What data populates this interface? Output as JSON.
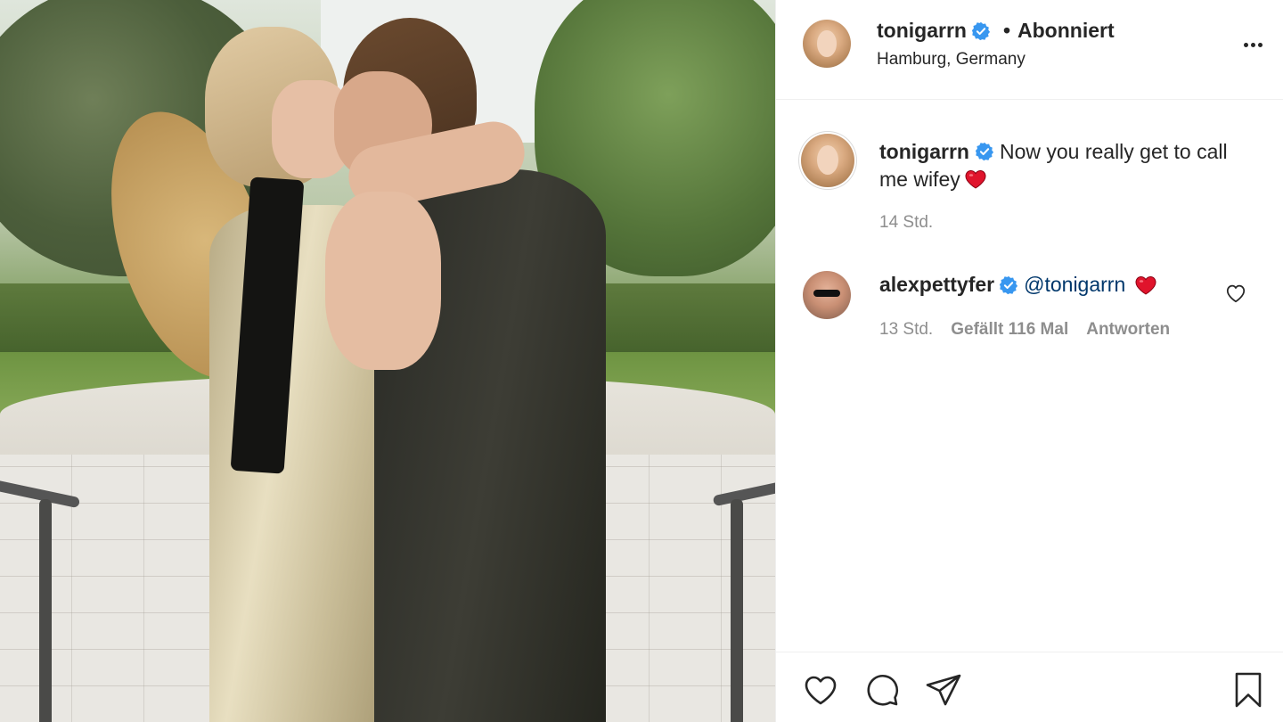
{
  "post": {
    "author": "tonigarrn",
    "follow_state": "Abonniert",
    "separator": "•",
    "location": "Hamburg, Germany"
  },
  "caption": {
    "username": "tonigarrn",
    "text": "Now you really get to call me wifey",
    "emoji": "red-heart",
    "time": "14 Std."
  },
  "comment": {
    "username": "alexpettyfer",
    "mention": "@tonigarrn",
    "emoji": "red-heart",
    "time": "13 Std.",
    "likes": "Gefällt 116 Mal",
    "reply": "Antworten"
  },
  "actions": {
    "icons": [
      "heart-icon",
      "comment-icon",
      "share-icon",
      "bookmark-icon"
    ]
  },
  "colors": {
    "verified": "#3897f0",
    "heart": "#ed4956",
    "mention": "#00376b",
    "muted": "#8e8e8e",
    "text": "#262626"
  }
}
